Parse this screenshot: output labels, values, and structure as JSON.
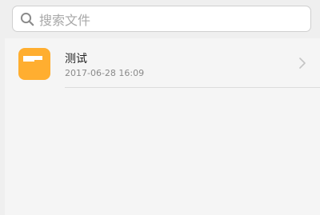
{
  "search": {
    "placeholder": "搜索文件",
    "icon": "search-icon"
  },
  "files": [
    {
      "name": "测试",
      "modified": "2017-06-28 16:09",
      "icon": "folder-icon",
      "trailing_icon": "chevron-right-icon"
    }
  ],
  "colors": {
    "folder_accent": "#ffae30",
    "background": "#efefef",
    "list_background": "#f5f5f5"
  }
}
